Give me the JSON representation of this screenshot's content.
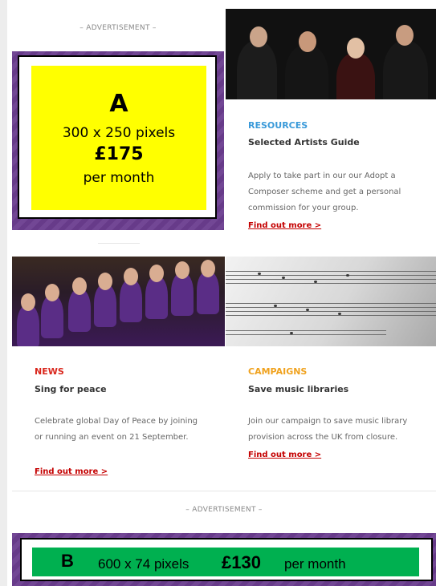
{
  "ads": {
    "top_label": "– ADVERTISEMENT –",
    "bottom_label": "– ADVERTISEMENT –",
    "ad_a": {
      "letter": "A",
      "size": "300 x 250 pixels",
      "price": "£175",
      "period": "per month",
      "bg_color": "#ffff00"
    },
    "ad_b": {
      "letter": "B",
      "size": "600 x 74 pixels",
      "price": "£130",
      "period": "per month",
      "bg_color": "#00b050"
    }
  },
  "cards": {
    "resources": {
      "category": "RESOURCES",
      "title": "Selected Artists Guide",
      "text": "Apply to take part in our our Adopt a Composer scheme and get a personal commission for your group.",
      "link": "Find out more >",
      "category_color": "#3a9ad9"
    },
    "news": {
      "category": "NEWS",
      "title": "Sing for peace",
      "text": "Celebrate global Day of Peace by joining or running an event on 21 September.",
      "link": "Find out more >",
      "category_color": "#d9261c"
    },
    "campaigns": {
      "category": "CAMPAIGNS",
      "title": "Save music libraries",
      "text": "Join our campaign to save music library provision across the UK from closure.",
      "link": "Find out more >",
      "category_color": "#f0a21e"
    }
  },
  "images": {
    "quartet": "string-quartet-photo",
    "choir": "choir-photo",
    "sheet_music": "sheet-music-photo"
  }
}
